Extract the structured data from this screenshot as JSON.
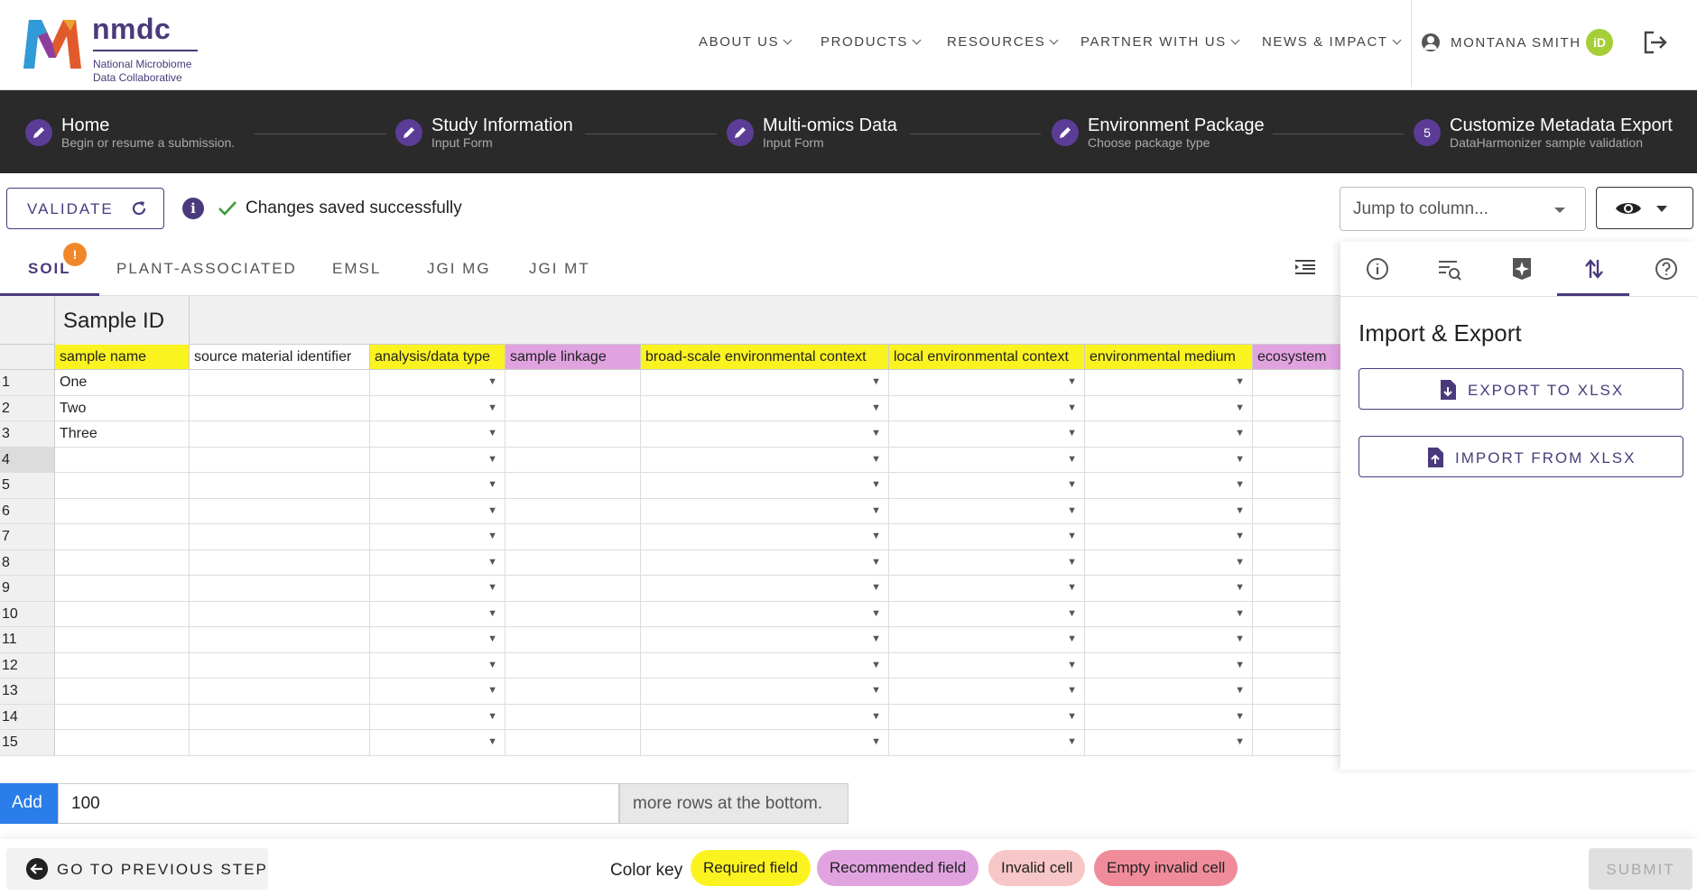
{
  "header": {
    "logo_word": "nmdc",
    "logo_sub1": "National Microbiome",
    "logo_sub2": "Data Collaborative",
    "nav": [
      "ABOUT US",
      "PRODUCTS",
      "RESOURCES",
      "PARTNER WITH US",
      "NEWS & IMPACT"
    ],
    "user_name": "MONTANA SMITH",
    "orcid_label": "iD"
  },
  "stepper": {
    "steps": [
      {
        "title": "Home",
        "desc": "Begin or resume a submission.",
        "icon": "pencil-icon"
      },
      {
        "title": "Study Information",
        "desc": "Input Form",
        "icon": "pencil-icon"
      },
      {
        "title": "Multi-omics Data",
        "desc": "Input Form",
        "icon": "pencil-icon"
      },
      {
        "title": "Environment Package",
        "desc": "Choose package type",
        "icon": "pencil-icon"
      },
      {
        "title": "Customize Metadata Export",
        "desc": "DataHarmonizer sample validation",
        "number": "5"
      }
    ]
  },
  "toolbar": {
    "validate_label": "VALIDATE",
    "info_glyph": "i",
    "saved_text": "Changes saved successfully",
    "jump_placeholder": "Jump to column..."
  },
  "tabs": {
    "items": [
      "SOIL",
      "PLANT-ASSOCIATED",
      "EMSL",
      "JGI MG",
      "JGI MT"
    ],
    "active": "SOIL",
    "badge": "!"
  },
  "grid": {
    "group_label": "Sample ID",
    "columns": [
      {
        "label": "sample name",
        "kind": "required"
      },
      {
        "label": "source material identifier",
        "kind": "none"
      },
      {
        "label": "analysis/data type",
        "kind": "required"
      },
      {
        "label": "sample linkage",
        "kind": "recommended"
      },
      {
        "label": "broad-scale environmental context",
        "kind": "required"
      },
      {
        "label": "local environmental context",
        "kind": "required"
      },
      {
        "label": "environmental medium",
        "kind": "required"
      },
      {
        "label": "ecosystem",
        "kind": "recommended"
      }
    ],
    "row_numbers": [
      "1",
      "2",
      "3",
      "4",
      "5",
      "6",
      "7",
      "8",
      "9",
      "10",
      "11",
      "12",
      "13",
      "14",
      "15"
    ],
    "sample_names": [
      "One",
      "Two",
      "Three",
      "",
      "",
      "",
      "",
      "",
      "",
      "",
      "",
      "",
      "",
      "",
      ""
    ],
    "selected_row": "4",
    "dropdown_glyph": "▼"
  },
  "panel": {
    "title": "Import & Export",
    "export_label": "EXPORT TO XLSX",
    "import_label": "IMPORT FROM XLSX",
    "tab_icons": [
      "info-icon",
      "search-list-icon",
      "sparkle-icon",
      "import-export-icon",
      "help-icon"
    ]
  },
  "add_rows": {
    "button": "Add",
    "value": "100",
    "suffix": "more rows at the bottom."
  },
  "footer": {
    "prev_label": "GO TO PREVIOUS STEP",
    "color_key_label": "Color key",
    "chips": [
      {
        "label": "Required field",
        "color": "#fbf31f"
      },
      {
        "label": "Recommended field",
        "color": "#e0a3e0"
      },
      {
        "label": "Invalid cell",
        "color": "#f7c6c6"
      },
      {
        "label": "Empty invalid cell",
        "color": "#f08c9a"
      }
    ],
    "submit_label": "SUBMIT"
  },
  "colors": {
    "brand": "#4a3a7c",
    "stepper_bg": "#2a2a2a",
    "add_button": "#2b7de9",
    "badge": "#f0882b"
  }
}
